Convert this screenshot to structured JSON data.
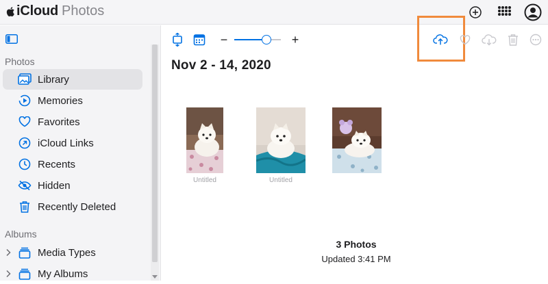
{
  "app": {
    "brand": "iCloud",
    "section": "Photos"
  },
  "sidebar": {
    "photos_heading": "Photos",
    "items": [
      {
        "label": "Library",
        "icon": "library-icon",
        "selected": true
      },
      {
        "label": "Memories",
        "icon": "memories-icon"
      },
      {
        "label": "Favorites",
        "icon": "heart-icon"
      },
      {
        "label": "iCloud Links",
        "icon": "link-icon"
      },
      {
        "label": "Recents",
        "icon": "clock-icon"
      },
      {
        "label": "Hidden",
        "icon": "eye-slash-icon"
      },
      {
        "label": "Recently Deleted",
        "icon": "trash-icon"
      }
    ],
    "albums_heading": "Albums",
    "albums": [
      {
        "label": "Media Types",
        "icon": "stack-icon"
      },
      {
        "label": "My Albums",
        "icon": "stack-icon"
      }
    ]
  },
  "toolbar": {
    "zoom_minus": "−",
    "zoom_plus": "+",
    "zoom_level": 0.65
  },
  "main": {
    "date_title": "Nov 2 - 14, 2020",
    "photos": [
      {
        "caption": "Untitled"
      },
      {
        "caption": "Untitled"
      },
      {
        "caption": ""
      }
    ],
    "count": "3 Photos",
    "updated": "Updated 3:41 PM"
  },
  "colors": {
    "accent": "#0071e3",
    "highlight": "#f08a3c",
    "disabled": "#c7c7cc"
  }
}
